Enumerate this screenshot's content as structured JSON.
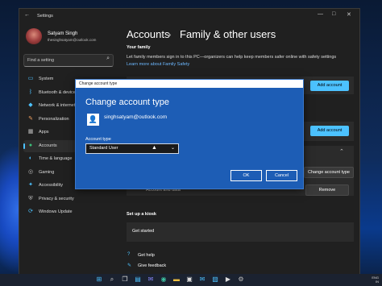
{
  "window": {
    "title": "Settings",
    "back_icon": "back-arrow-icon",
    "controls": [
      "—",
      "□",
      "✕"
    ]
  },
  "user": {
    "name": "Satyam Singh",
    "email": "thesinghsatyam@outlook.com"
  },
  "search": {
    "placeholder": "Find a setting",
    "icon": "search-icon"
  },
  "sidebar": {
    "items": [
      {
        "label": "System",
        "icon": "system-icon",
        "glyph": "▭",
        "color": "#4cc2ff"
      },
      {
        "label": "Bluetooth & devices",
        "icon": "bluetooth-icon",
        "glyph": "ᛒ",
        "color": "#4cc2ff"
      },
      {
        "label": "Network & internet",
        "icon": "network-icon",
        "glyph": "◆",
        "color": "#4cc2ff"
      },
      {
        "label": "Personalization",
        "icon": "brush-icon",
        "glyph": "✎",
        "color": "#f0a060"
      },
      {
        "label": "Apps",
        "icon": "apps-icon",
        "glyph": "▦",
        "color": "#bbbbbb"
      },
      {
        "label": "Accounts",
        "icon": "accounts-icon",
        "glyph": "●",
        "color": "#3cc07a"
      },
      {
        "label": "Time & language",
        "icon": "globe-icon",
        "glyph": "◐",
        "color": "#4cc2ff"
      },
      {
        "label": "Gaming",
        "icon": "gaming-icon",
        "glyph": "◎",
        "color": "#bbbbbb"
      },
      {
        "label": "Accessibility",
        "icon": "accessibility-icon",
        "glyph": "✦",
        "color": "#4cc2ff"
      },
      {
        "label": "Privacy & security",
        "icon": "shield-icon",
        "glyph": "⛨",
        "color": "#bbbbbb"
      },
      {
        "label": "Windows Update",
        "icon": "update-icon",
        "glyph": "⟳",
        "color": "#4cc2ff"
      }
    ],
    "active_index": 5
  },
  "main": {
    "breadcrumb_parent": "Accounts",
    "breadcrumb_sep": "›",
    "breadcrumb_current": "Family & other users",
    "your_family": {
      "heading": "Your family",
      "description": "Let family members sign in to this PC—organizers can help keep members safer online with safety settings",
      "link": "Learn more about Family Safety",
      "add_button": "Add account"
    },
    "other_users": {
      "add_button": "Add account",
      "change_button": "Change account type",
      "account_data_label": "Account and data",
      "remove_button": "Remove"
    },
    "kiosk": {
      "heading": "Set up a kiosk",
      "get_started": "Get started"
    },
    "get_help": "Get help",
    "give_feedback": "Give feedback"
  },
  "dialog": {
    "titlebar": "Change account type",
    "heading": "Change account type",
    "email": "singhsatyam@outlook.com",
    "type_label": "Account type",
    "type_value": "Standard User",
    "ok": "OK",
    "cancel": "Cancel"
  },
  "taskbar": {
    "icons": [
      "windows-start-icon",
      "search-icon",
      "task-view-icon",
      "widgets-icon",
      "chat-icon",
      "edge-icon",
      "file-explorer-icon",
      "store-icon",
      "mail-icon",
      "photos-icon",
      "terminal-icon",
      "settings-icon"
    ],
    "tray_lang": "ENG",
    "tray_region": "IN"
  }
}
